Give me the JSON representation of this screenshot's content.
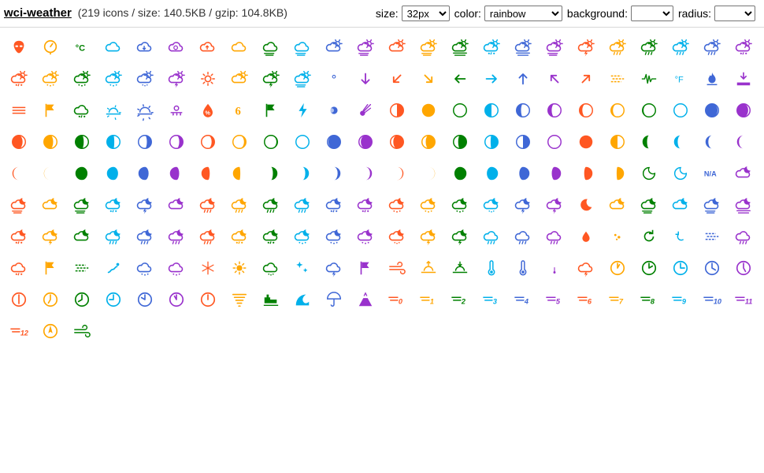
{
  "header": {
    "title": "wci-weather",
    "meta": "(219 icons / size: 140.5KB / gzip: 104.8KB)"
  },
  "controls": {
    "size_label": "size:",
    "size_value": "32px",
    "color_label": "color:",
    "color_value": "rainbow",
    "background_label": "background:",
    "background_value": "",
    "radius_label": "radius:",
    "radius_value": ""
  },
  "palette": [
    "#ff5722",
    "#ffa600",
    "#008000",
    "#00b0ea",
    "#3f67d6",
    "#9932cc"
  ],
  "icons": [
    "alien",
    "barometer",
    "celsius",
    "cloud",
    "cloud-down",
    "cloud-refresh",
    "cloud-up",
    "cloudy",
    "cloudy-gusts",
    "cloudy-windy",
    "day-cloudy",
    "day-cloudy-gusts",
    "day-cloudy-high",
    "day-cloudy-windy",
    "day-fog",
    "day-hail",
    "day-haze",
    "day-light-wind",
    "day-lightning",
    "day-rain",
    "day-rain-mix",
    "day-rain-wind",
    "day-showers",
    "day-sleet",
    "day-sleet-storm",
    "day-snow",
    "day-snow-thunderstorm",
    "day-snow-wind",
    "day-sprinkle",
    "day-storm-showers",
    "day-sunny",
    "day-sunny-overcast",
    "day-thunderstorm",
    "day-windy",
    "degrees",
    "direction-down",
    "direction-down-left",
    "direction-down-right",
    "direction-left",
    "direction-right",
    "direction-up",
    "direction-up-left",
    "direction-up-right",
    "dust",
    "earthquake",
    "fahrenheit",
    "fire",
    "flood",
    "fog",
    "gale-warning",
    "hail",
    "horizon",
    "horizon-alt",
    "hot",
    "humidity",
    "hurricane",
    "hurricane-warning",
    "lightning",
    "lunar-eclipse",
    "meteor",
    "moon-alt-first-quarter",
    "moon-alt-full",
    "moon-alt-new",
    "moon-alt-third-quarter",
    "moon-alt-waning-crescent-1",
    "moon-alt-waning-crescent-2",
    "moon-alt-waning-crescent-3",
    "moon-alt-waning-crescent-4",
    "moon-alt-waning-crescent-5",
    "moon-alt-waning-crescent-6",
    "moon-alt-waning-gibbous-1",
    "moon-alt-waning-gibbous-2",
    "moon-alt-waning-gibbous-3",
    "moon-alt-waning-gibbous-4",
    "moon-alt-waning-gibbous-5",
    "moon-alt-waning-gibbous-6",
    "moon-alt-waxing-crescent-1",
    "moon-alt-waxing-crescent-2",
    "moon-alt-waxing-crescent-3",
    "moon-alt-waxing-crescent-4",
    "moon-alt-waxing-crescent-5",
    "moon-alt-waxing-crescent-6",
    "moon-alt-waxing-gibbous-1",
    "moon-alt-waxing-gibbous-2",
    "moon-alt-waxing-gibbous-3",
    "moon-alt-waxing-gibbous-4",
    "moon-alt-waxing-gibbous-5",
    "moon-alt-waxing-gibbous-6",
    "moon-first-quarter",
    "moon-full",
    "moon-new",
    "moon-third-quarter",
    "moon-waning-crescent-1",
    "moon-waning-crescent-2",
    "moon-waning-crescent-3",
    "moon-waning-crescent-4",
    "moon-waning-crescent-5",
    "moon-waning-crescent-6",
    "moon-waning-gibbous-1",
    "moon-waning-gibbous-2",
    "moon-waning-gibbous-3",
    "moon-waning-gibbous-4",
    "moon-waning-gibbous-5",
    "moon-waning-gibbous-6",
    "moon-waxing-crescent-1",
    "moon-waxing-crescent-2",
    "moon-waxing-crescent-3",
    "moon-waxing-crescent-4",
    "moon-waxing-crescent-5",
    "moon-waxing-crescent-6",
    "moon-waxing-gibbous-1",
    "moon-waxing-gibbous-2",
    "moon-waxing-gibbous-3",
    "moon-waxing-gibbous-4",
    "moon-waxing-gibbous-5",
    "moon-waxing-gibbous-6",
    "moonrise",
    "moonset",
    "na",
    "night-alt-cloudy",
    "night-alt-cloudy-gusts",
    "night-alt-cloudy-high",
    "night-alt-cloudy-windy",
    "night-alt-hail",
    "night-alt-lightning",
    "night-alt-partly-cloudy",
    "night-alt-rain",
    "night-alt-rain-mix",
    "night-alt-rain-wind",
    "night-alt-showers",
    "night-alt-sleet",
    "night-alt-sleet-storm",
    "night-alt-snow",
    "night-alt-snow-thunderstorm",
    "night-alt-snow-wind",
    "night-alt-sprinkle",
    "night-alt-storm-showers",
    "night-alt-thunderstorm",
    "night-clear",
    "night-cloudy",
    "night-cloudy-gusts",
    "night-cloudy-high",
    "night-cloudy-windy",
    "night-fog",
    "night-hail",
    "night-lightning",
    "night-partly-cloudy",
    "night-rain",
    "night-rain-mix",
    "night-rain-wind",
    "night-showers",
    "night-sleet",
    "night-sleet-storm",
    "night-snow",
    "night-snow-thunderstorm",
    "night-snow-wind",
    "night-sprinkle",
    "night-storm-showers",
    "night-thunderstorm",
    "rain",
    "rain-mix",
    "rain-wind",
    "raindrop",
    "raindrops",
    "refresh",
    "refresh-alt",
    "sandstorm",
    "showers",
    "sleet",
    "small-craft-advisory",
    "smog",
    "smoke",
    "snow",
    "snow-wind",
    "snowflake-cold",
    "solar-eclipse",
    "sprinkle",
    "stars",
    "storm-showers",
    "storm-warning",
    "strong-wind",
    "sunrise",
    "sunset",
    "thermometer",
    "thermometer-exterior",
    "thermometer-internal",
    "thunderstorm",
    "time-1",
    "time-2",
    "time-3",
    "time-4",
    "time-5",
    "time-6",
    "time-7",
    "time-8",
    "time-9",
    "time-10",
    "time-11",
    "time-12",
    "tornado",
    "train",
    "tsunami",
    "umbrella",
    "volcano",
    "wind-beaufort-0",
    "wind-beaufort-1",
    "wind-beaufort-2",
    "wind-beaufort-3",
    "wind-beaufort-4",
    "wind-beaufort-5",
    "wind-beaufort-6",
    "wind-beaufort-7",
    "wind-beaufort-8",
    "wind-beaufort-9",
    "wind-beaufort-10",
    "wind-beaufort-11",
    "wind-beaufort-12",
    "wind-deg",
    "windy"
  ]
}
